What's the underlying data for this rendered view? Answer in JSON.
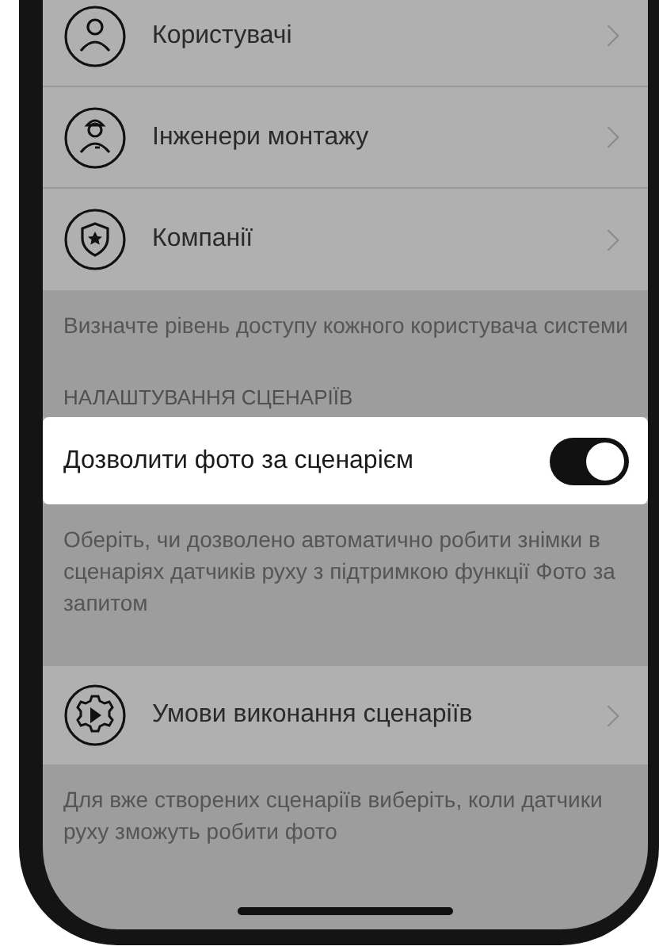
{
  "sections": [
    {
      "items": [
        {
          "kind": "nav",
          "label": "Користувачі"
        },
        {
          "kind": "nav",
          "label": "Інженери монтажу"
        },
        {
          "kind": "nav",
          "label": "Компанії"
        }
      ],
      "footer": "Визначте рівень доступу кожного користувача системи"
    },
    {
      "header": "НАЛАШТУВАННЯ СЦЕНАРІЇВ",
      "items": [
        {
          "kind": "toggle",
          "label": "Дозволити фото за сценарієм",
          "on": true
        }
      ],
      "footer": "Оберіть, чи дозволено автоматично робити знімки в сценаріях датчиків руху з підтримкою функції Фото за запитом"
    },
    {
      "items": [
        {
          "kind": "nav",
          "label": "Умови виконання сценаріїв"
        }
      ],
      "footer": "Для вже створених сценаріїв виберіть, коли датчики руху зможуть робити фото"
    }
  ]
}
